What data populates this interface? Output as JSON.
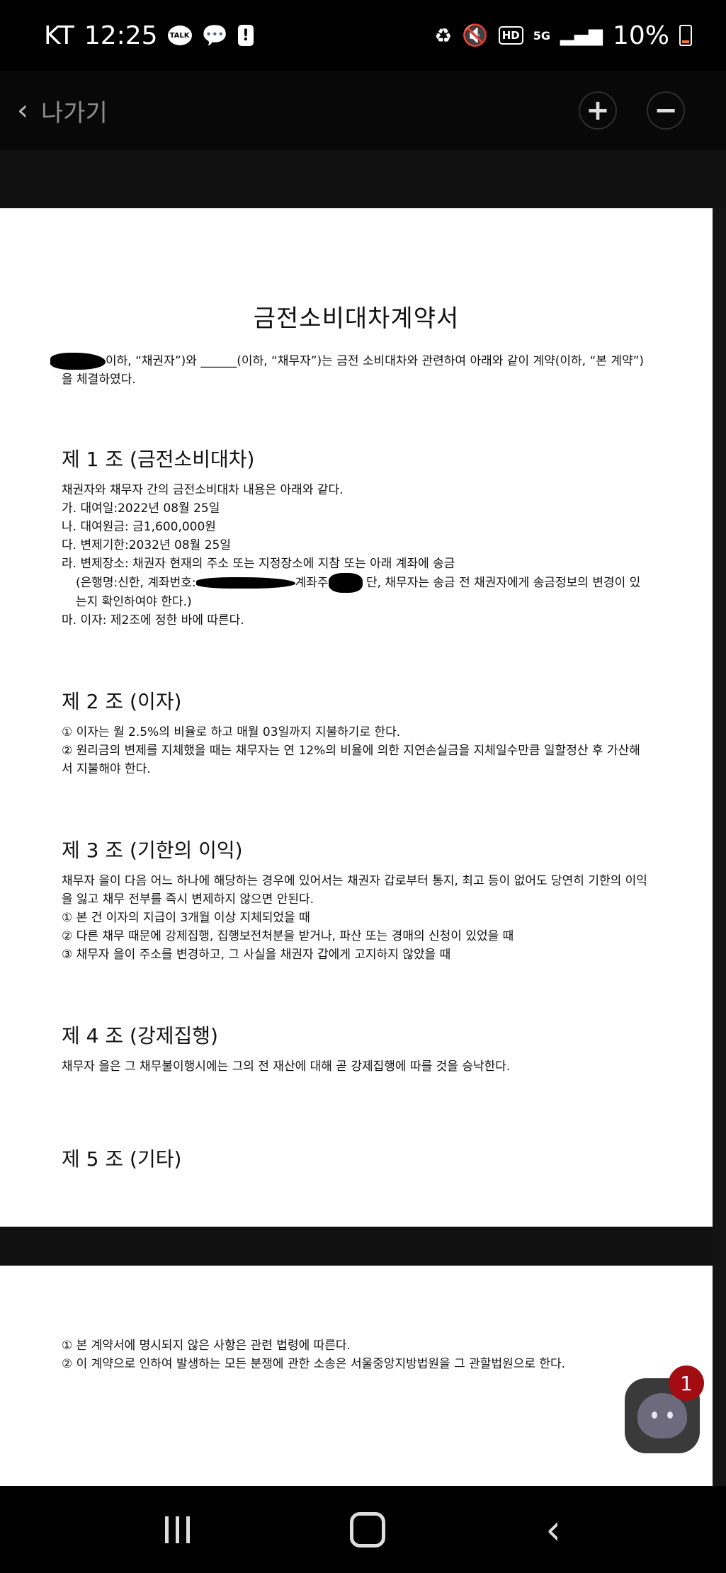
{
  "status_bar": {
    "carrier": "KT",
    "time": "12:25",
    "talk_label": "TALK",
    "network": "5G",
    "hd_label": "HD",
    "battery": "10%"
  },
  "app_bar": {
    "back_label": "나가기",
    "zoom_in": "+",
    "zoom_out": "−"
  },
  "document": {
    "title": "금전소비대차계약서",
    "intro": "이하, “채권자”)와 ______(이하, “채무자”)는 금전 소비대차와 관련하여 아래와 같이 계약(이하, “본 계약”)을 체결하였다.",
    "articles": [
      {
        "heading": "제 1 조 (금전소비대차)",
        "lines": [
          "채권자와 채무자 간의 금전소비대차 내용은 아래와 같다.",
          "가. 대여일:2022년 08월 25일",
          "나. 대여원금: 금1,600,000원",
          "다. 변제기한:2032년 08월 25일",
          "라. 변제장소: 채권자 현재의 주소 또는 지정장소에 지참 또는 아래 계좌에 송금"
        ],
        "bank_prefix": "(은행명:신한, 계좌번호:",
        "bank_mid": "계좌주",
        "bank_suffix": "단, 채무자는 송금 전 채권자에게 송금정보의 변경이 있는지 확인하여야 한다.)",
        "last_line": "마. 이자: 제2조에 정한 바에 따른다."
      },
      {
        "heading": "제 2 조 (이자)",
        "lines": [
          "① 이자는 월 2.5%의 비율로 하고 매월 03일까지 지불하기로 한다.",
          "② 원리금의 변제를 지체했을 때는 채무자는 연 12%의 비율에 의한 지연손실금을 지체일수만큼 일할정산 후 가산해서 지불해야 한다."
        ]
      },
      {
        "heading": "제 3 조 (기한의 이익)",
        "lines": [
          "채무자 을이 다음 어느 하나에 해당하는 경우에 있어서는 채권자 갑로부터 통지, 최고 등이 없어도 당연히 기한의 이익을 잃고 채무 전부를 즉시 변제하지 않으면 안된다.",
          "① 본 건 이자의 지급이 3개월 이상 지체되었을 때",
          "② 다른 채무 때문에 강제집행, 집행보전처분을 받거나, 파산 또는 경매의 신청이 있었을 때",
          "③ 채무자 을이 주소를 변경하고, 그 사실을 채권자 갑에게 고지하지 않았을 때"
        ]
      },
      {
        "heading": "제 4 조 (강제집행)",
        "lines": [
          "채무자 을은 그 채무불이행시에는 그의 전 재산에 대해 곧 강제집행에 따를 것을 승낙한다."
        ]
      },
      {
        "heading": "제 5 조 (기타)",
        "lines": []
      }
    ],
    "page2_lines": [
      "① 본 계약서에 명시되지 않은 사항은 관련 법령에 따른다.",
      "② 이 계약으로 인하여 발생하는 모든 분쟁에 관한 소송은 서울중앙지방법원을 그 관할법원으로 한다."
    ]
  },
  "chat_badge_count": "1"
}
